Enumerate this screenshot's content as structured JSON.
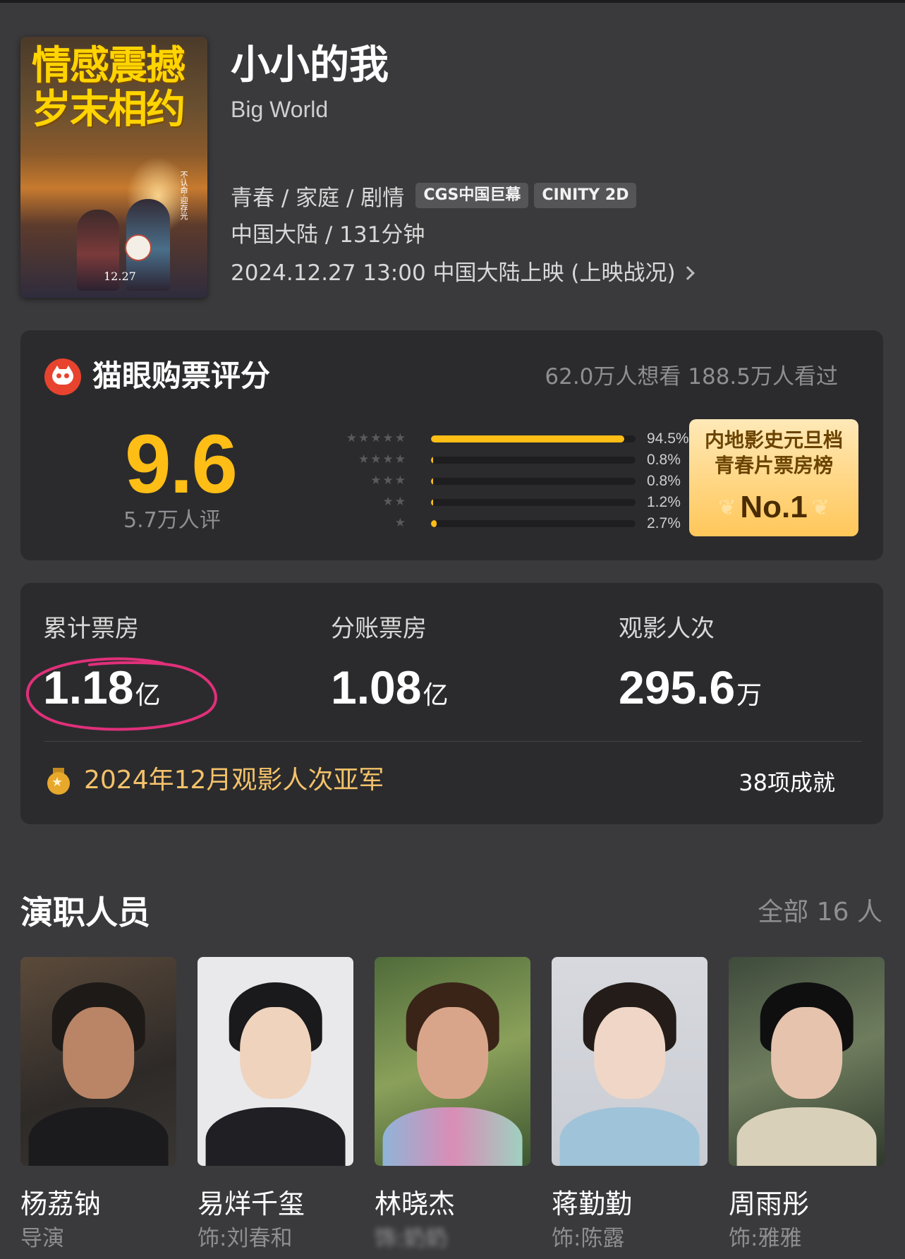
{
  "movie": {
    "title": "小小的我",
    "subtitle": "Big World",
    "genres": "青春 / 家庭 / 剧情",
    "tags": [
      "CGS中国巨幕",
      "CINITY 2D"
    ],
    "region_runtime": "中国大陆 / 131分钟",
    "release": "2024.12.27 13:00 中国大陆上映 (上映战况)",
    "poster": {
      "headline_1": "情感震撼",
      "headline_2": "岁末相约",
      "side_text": "不认命·迎存光",
      "date": "12.27"
    }
  },
  "rating": {
    "brand": "猫眼购票评分",
    "audience": "62.0万人想看  188.5万人看过",
    "score": "9.6",
    "count": "5.7万人评",
    "distribution": [
      {
        "stars": "★★★★★",
        "pct_label": "94.5%",
        "pct": 94.5
      },
      {
        "stars": "★★★★",
        "pct_label": "0.8%",
        "pct": 0.8
      },
      {
        "stars": "★★★",
        "pct_label": "0.8%",
        "pct": 0.8
      },
      {
        "stars": "★★",
        "pct_label": "1.2%",
        "pct": 1.2
      },
      {
        "stars": "★",
        "pct_label": "2.7%",
        "pct": 2.7
      }
    ],
    "rank_badge": {
      "line1": "内地影史元旦档",
      "line2": "青春片票房榜",
      "rank": "No.1"
    }
  },
  "box_office": {
    "cumulative": {
      "label": "累计票房",
      "value": "1.18",
      "unit": "亿"
    },
    "split": {
      "label": "分账票房",
      "value": "1.08",
      "unit": "亿"
    },
    "admissions": {
      "label": "观影人次",
      "value": "295.6",
      "unit": "万"
    },
    "award": "2024年12月观影人次亚军",
    "achievements": "38项成就",
    "highlight_color": "#e0307a"
  },
  "cast": {
    "title": "演职人员",
    "all": "全部 16 人",
    "members": [
      {
        "name": "杨荔钠",
        "role": "导演"
      },
      {
        "name": "易烊千玺",
        "role": "饰:刘春和"
      },
      {
        "name": "林晓杰",
        "role": "饰:奶奶"
      },
      {
        "name": "蒋勤勤",
        "role": "饰:陈露"
      },
      {
        "name": "周雨彤",
        "role": "饰:雅雅"
      }
    ]
  },
  "colors": {
    "background": "#3a3a3c",
    "card": "#2b2b2d",
    "accent": "#ffbe16",
    "brand": "#e8432e"
  }
}
